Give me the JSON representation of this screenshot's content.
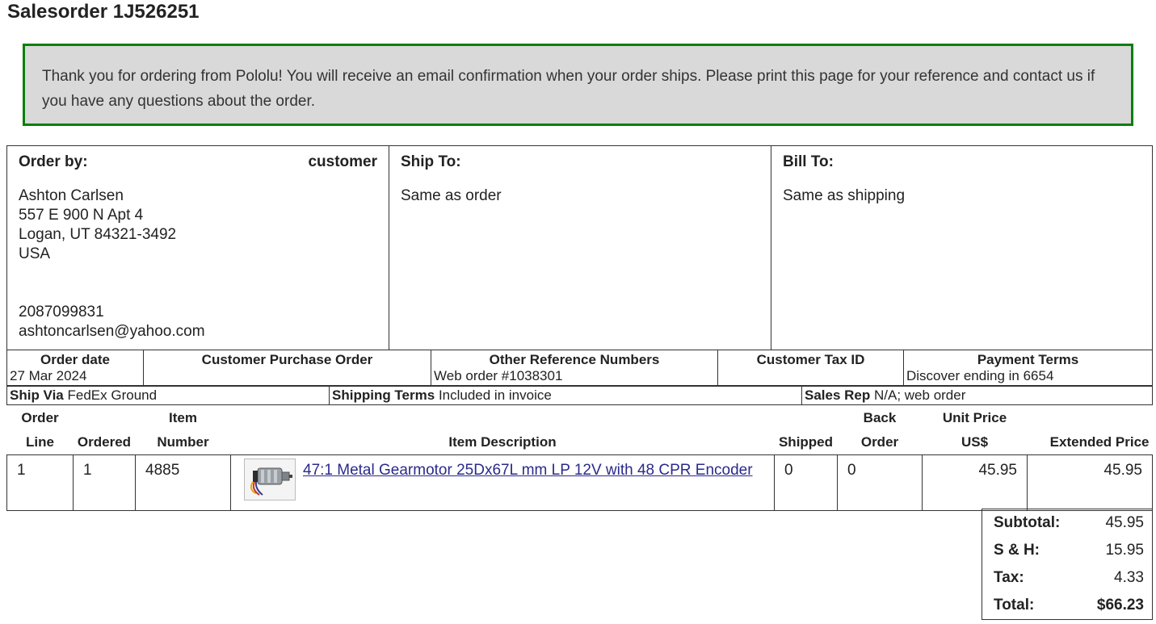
{
  "page": {
    "title": "Salesorder 1J526251"
  },
  "notice": {
    "text": "Thank you for ordering from Pololu! You will receive an email confirmation when your order ships. Please print this page for your reference and contact us if you have any questions about the order."
  },
  "order_by": {
    "heading": "Order by:",
    "role": "customer",
    "name": "Ashton Carlsen",
    "address1": "557 E 900 N Apt 4",
    "address2": "Logan, UT 84321-3492",
    "country": "USA",
    "phone": "2087099831",
    "email": "ashtoncarlsen@yahoo.com"
  },
  "ship_to": {
    "heading": "Ship To:",
    "value": "Same as order"
  },
  "bill_to": {
    "heading": "Bill To:",
    "value": "Same as shipping"
  },
  "meta": {
    "order_date_label": "Order date",
    "order_date": "27 Mar 2024",
    "cpo_label": "Customer Purchase Order",
    "cpo": "",
    "ref_label": "Other Reference Numbers",
    "ref": "Web order #1038301",
    "tax_label": "Customer Tax ID",
    "tax": "",
    "payment_label": "Payment Terms",
    "payment": "Discover ending in 6654",
    "ship_via_label": "Ship Via",
    "ship_via": "FedEx Ground",
    "shipping_terms_label": "Shipping Terms",
    "shipping_terms": "Included in invoice",
    "sales_rep_label": "Sales Rep",
    "sales_rep": "N/A; web order"
  },
  "items_table": {
    "headers": {
      "order_line_top": "Order",
      "order_line_bottom": "Line",
      "ordered": "Ordered",
      "item_number_top": "Item",
      "item_number_bottom": "Number",
      "description": "Item Description",
      "shipped": "Shipped",
      "back_order_top": "Back",
      "back_order_bottom": "Order",
      "unit_price_top": "Unit Price",
      "unit_price_bottom": "US$",
      "extended_price": "Extended Price"
    },
    "rows": [
      {
        "line": "1",
        "ordered": "1",
        "item_number": "4885",
        "description": "47:1 Metal Gearmotor 25Dx67L mm LP 12V with 48 CPR Encoder",
        "shipped": "0",
        "back_order": "0",
        "unit_price": "45.95",
        "extended_price": "45.95"
      }
    ]
  },
  "totals": {
    "subtotal_label": "Subtotal:",
    "subtotal": "45.95",
    "sh_label": "S & H:",
    "sh": "15.95",
    "tax_label": "Tax:",
    "tax": "4.33",
    "total_label": "Total:",
    "total": "$66.23"
  },
  "colors": {
    "notice_bg": "#d9d9d9",
    "notice_border": "#0a7f0a",
    "link": "#2a2a8c"
  },
  "icons": {
    "product_thumbnail": "gearmotor-thumbnail"
  }
}
